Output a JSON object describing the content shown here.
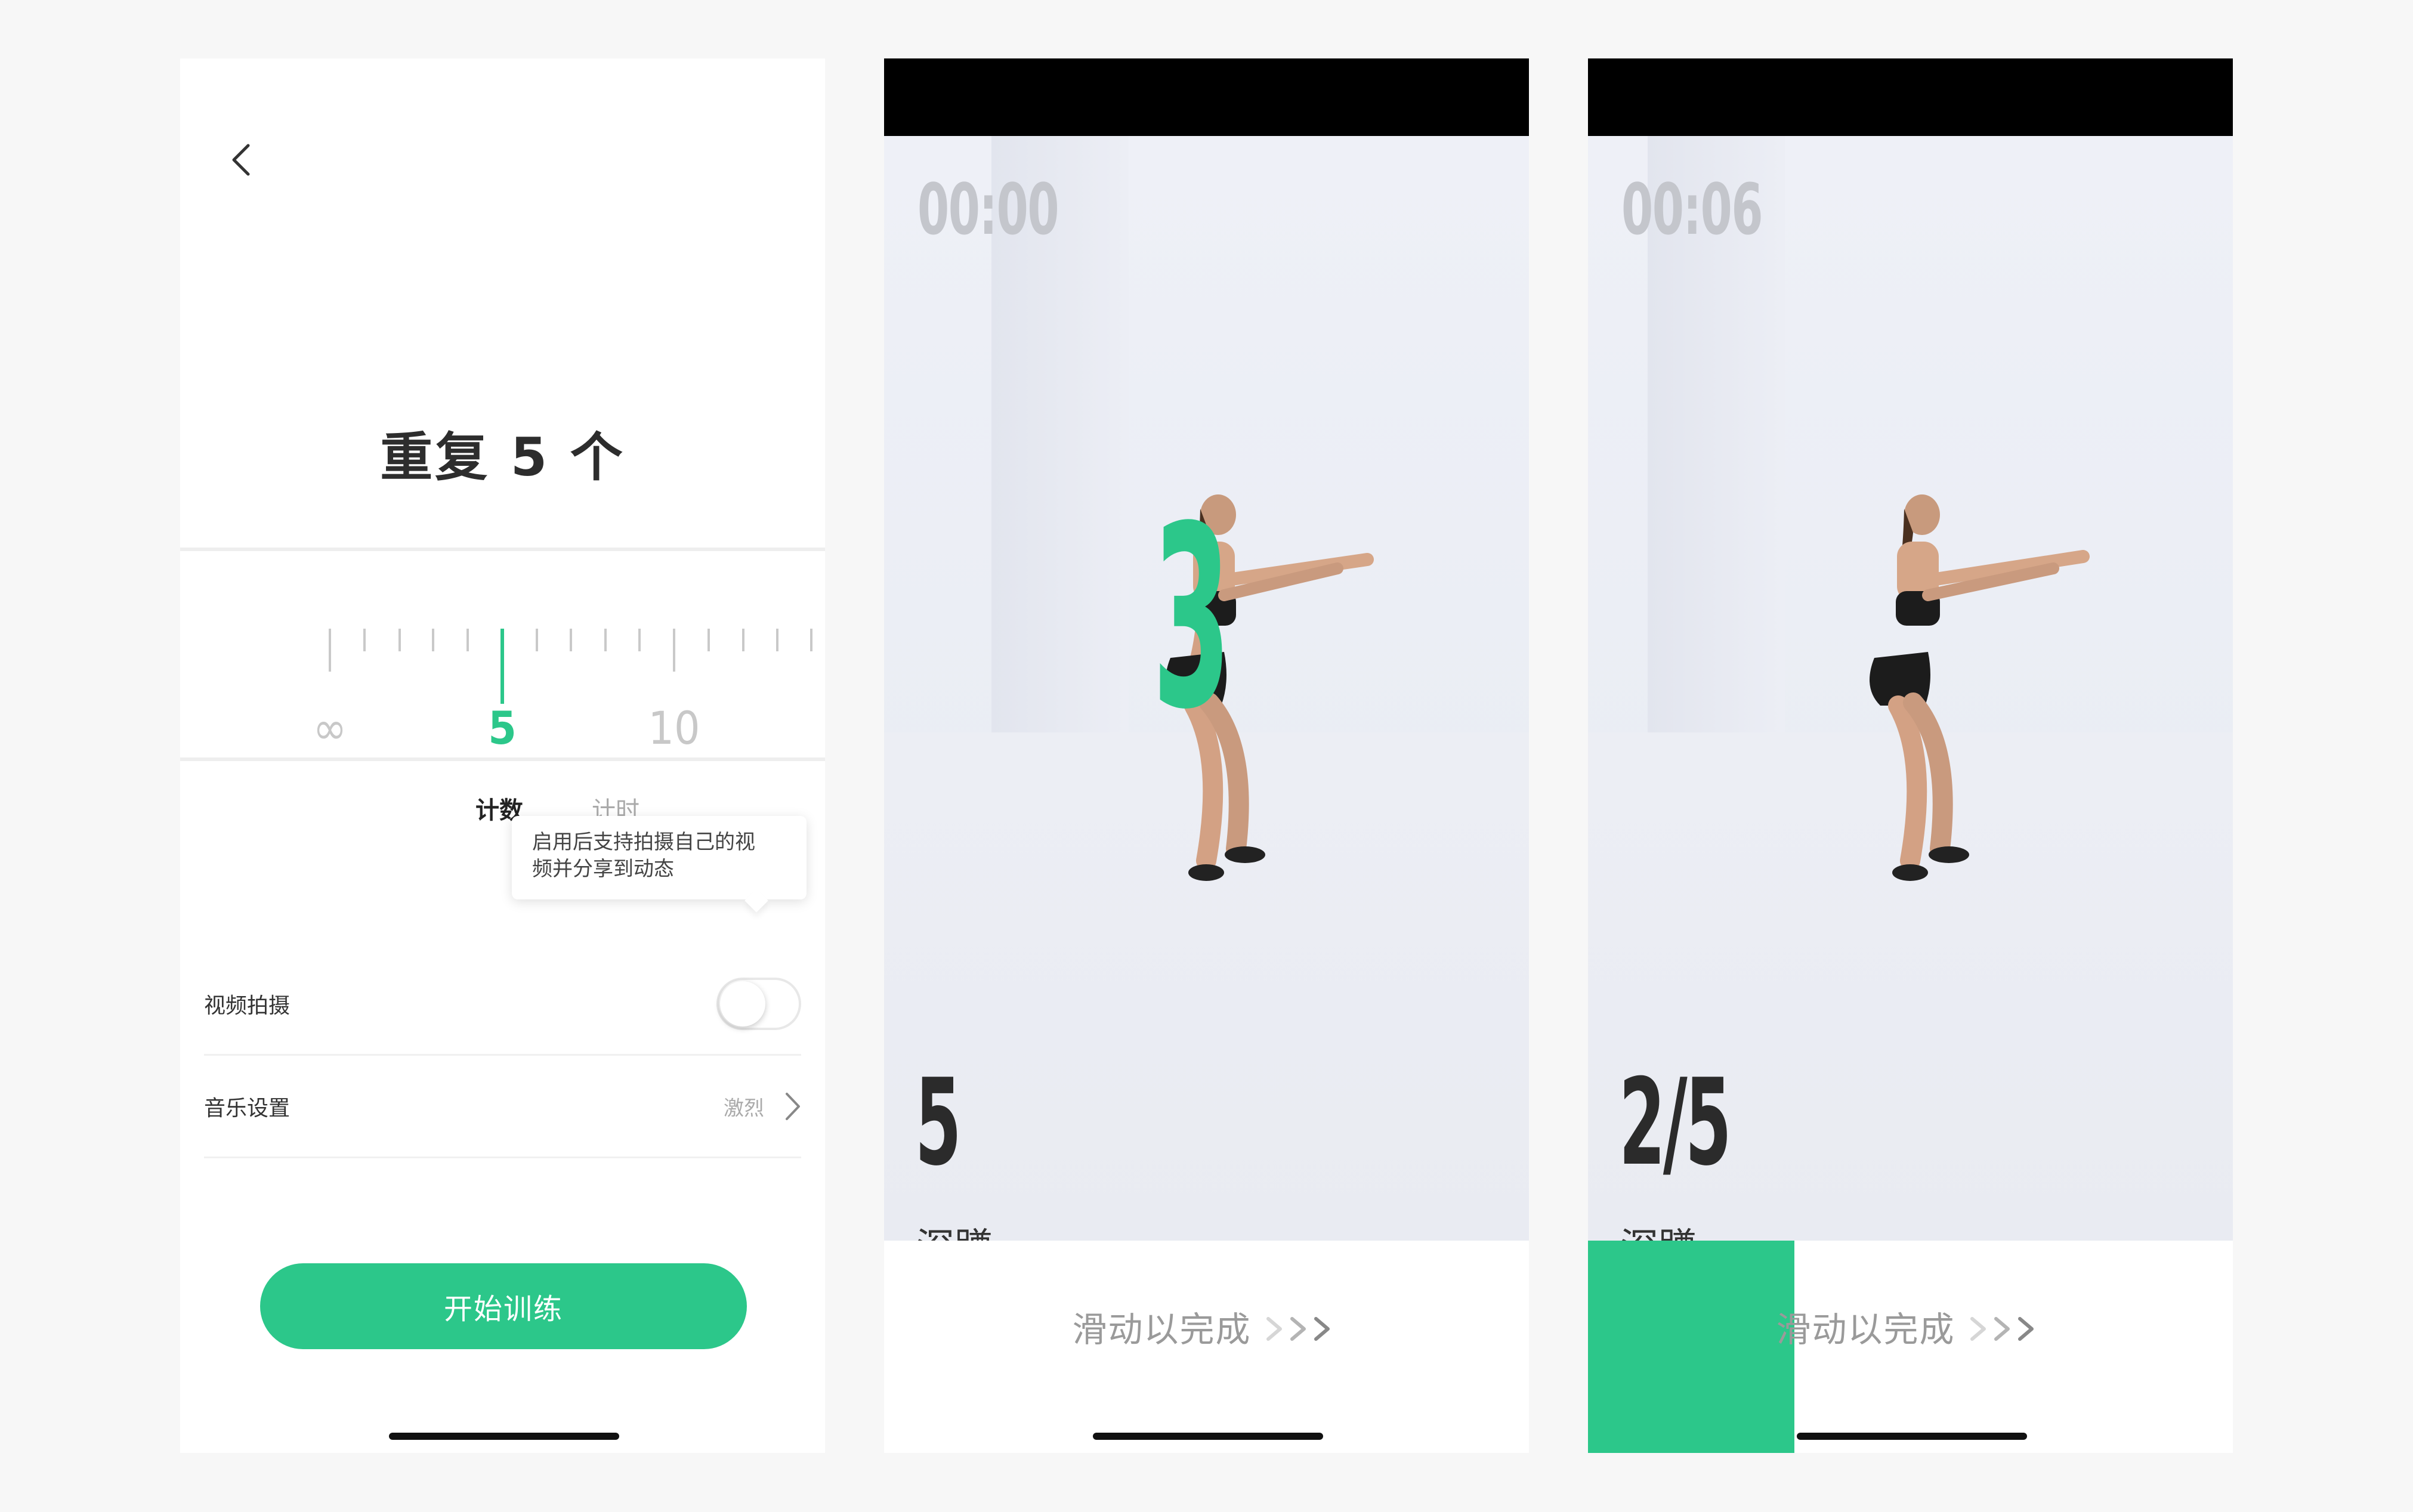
{
  "setup_screen": {
    "title": "重复 5 个",
    "ruler": {
      "labels": [
        "∞",
        "5",
        "10"
      ],
      "selected": "5"
    },
    "mode_tabs": [
      {
        "label": "计数",
        "active": true
      },
      {
        "label": "计时",
        "active": false
      }
    ],
    "tooltip_line1": "启用后支持拍摄自己的视",
    "tooltip_line2": "频并分享到动态",
    "video_capture": {
      "label": "视频拍摄",
      "enabled": false
    },
    "music": {
      "label": "音乐设置",
      "value": "激烈"
    },
    "start_button": "开始训练",
    "icons": [
      "chevron-left-icon",
      "chevron-right-icon"
    ]
  },
  "workout_start": {
    "timer": "00:00",
    "countdown": "3",
    "rep_count": "5",
    "exercise": "深蹲",
    "swipe_label": "滑动以完成",
    "swipe_progress": 0
  },
  "workout_progress": {
    "timer": "00:06",
    "rep_count": "2/5",
    "exercise": "深蹲",
    "swipe_label": "滑动以完成",
    "swipe_progress": 0.32
  },
  "colors": {
    "accent": "#2cc78a",
    "muted_text": "#aaaaaa",
    "timer_text": "#c4c6cc",
    "background": "#f7f7f7"
  }
}
